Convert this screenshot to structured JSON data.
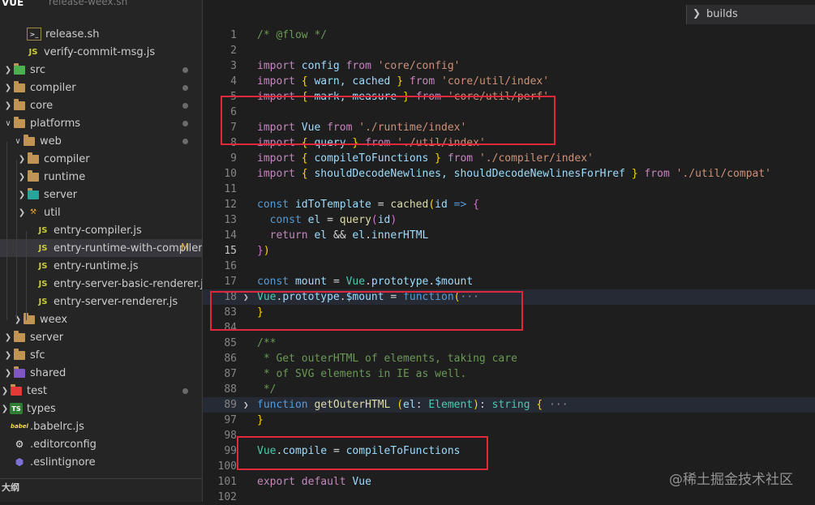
{
  "sidebar": {
    "title": "VUE",
    "faded_top": "release-weex.sh",
    "items": [
      {
        "label": "release.sh",
        "icon": "shell-file-icon"
      },
      {
        "label": "verify-commit-msg.js",
        "icon": "js-file-icon"
      },
      {
        "label": "src",
        "icon": "src-folder-icon"
      },
      {
        "label": "compiler",
        "icon": "folder-icon"
      },
      {
        "label": "core",
        "icon": "folder-icon"
      },
      {
        "label": "platforms",
        "icon": "folder-icon"
      },
      {
        "label": "web",
        "icon": "folder-icon"
      },
      {
        "label": "compiler",
        "icon": "folder-icon"
      },
      {
        "label": "runtime",
        "icon": "folder-icon"
      },
      {
        "label": "server",
        "icon": "server-folder-icon"
      },
      {
        "label": "util",
        "icon": "util-folder-icon"
      },
      {
        "label": "entry-compiler.js",
        "icon": "js-file-icon"
      },
      {
        "label": "entry-runtime-with-compiler.js",
        "icon": "js-file-icon",
        "badge": "M"
      },
      {
        "label": "entry-runtime.js",
        "icon": "js-file-icon"
      },
      {
        "label": "entry-server-basic-renderer.js",
        "icon": "js-file-icon"
      },
      {
        "label": "entry-server-renderer.js",
        "icon": "js-file-icon"
      },
      {
        "label": "weex",
        "icon": "folder-icon"
      },
      {
        "label": "server",
        "icon": "folder-icon"
      },
      {
        "label": "sfc",
        "icon": "folder-icon"
      },
      {
        "label": "shared",
        "icon": "shared-folder-icon"
      },
      {
        "label": "test",
        "icon": "test-folder-icon"
      },
      {
        "label": "types",
        "icon": "ts-folder-icon"
      },
      {
        "label": ".babelrc.js",
        "icon": "babel-file-icon"
      },
      {
        "label": ".editorconfig",
        "icon": "editorconfig-icon"
      },
      {
        "label": ".eslintignore",
        "icon": "eslint-icon"
      }
    ],
    "outline_label": "大纲"
  },
  "breadcrumb": {
    "label": "builds"
  },
  "editor": {
    "line_numbers": [
      "1",
      "2",
      "3",
      "4",
      "5",
      "6",
      "7",
      "8",
      "9",
      "10",
      "11",
      "12",
      "13",
      "14",
      "15",
      "16",
      "17",
      "18",
      "83",
      "84",
      "85",
      "86",
      "87",
      "88",
      "89",
      "97",
      "98",
      "99",
      "100",
      "101",
      "102"
    ],
    "lines": {
      "l1": [
        "/* @flow */"
      ],
      "l3": [
        "import",
        "config",
        "from",
        "'core/config'"
      ],
      "l4": [
        "import",
        "{",
        "warn,",
        "cached",
        "}",
        "from",
        "'core/util/index'"
      ],
      "l5": [
        "import",
        "{",
        "mark,",
        "measure",
        "}",
        "from",
        "'core/util/perf'"
      ],
      "l7": [
        "import",
        "Vue",
        "from",
        "'./runtime/index'"
      ],
      "l8": [
        "import",
        "{",
        "query",
        "}",
        "from",
        "'./util/index'"
      ],
      "l9": [
        "import",
        "{",
        "compileToFunctions",
        "}",
        "from",
        "'./compiler/index'"
      ],
      "l10": [
        "import",
        "{",
        "shouldDecodeNewlines,",
        "shouldDecodeNewlinesForHref",
        "}",
        "from",
        "'./util/compat'"
      ],
      "l12": [
        "const",
        "idToTemplate",
        "=",
        "cached",
        "(",
        "id",
        "=>",
        "{"
      ],
      "l13": [
        "const",
        "el",
        "=",
        "query",
        "(",
        "id",
        ")"
      ],
      "l14": [
        "return",
        "el",
        "&&",
        "el",
        ".",
        "innerHTML"
      ],
      "l15": [
        "}",
        ")"
      ],
      "l17": [
        "const",
        "mount",
        "=",
        "Vue",
        ".",
        "prototype",
        ".",
        "$mount"
      ],
      "l18": [
        "Vue",
        ".",
        "prototype",
        ".",
        "$mount",
        "=",
        "function",
        "(",
        "···"
      ],
      "l83": [
        "}"
      ],
      "l85": [
        "/**"
      ],
      "l86": [
        " * Get outerHTML of elements, taking care"
      ],
      "l87": [
        " * of SVG elements in IE as well."
      ],
      "l88": [
        " */"
      ],
      "l89": [
        "function",
        "getOuterHTML",
        "(",
        "el",
        ":",
        "Element",
        ")",
        ":",
        "string",
        "{",
        "···"
      ],
      "l97": [
        "}"
      ],
      "l99": [
        "Vue",
        ".",
        "compile",
        "=",
        "compileToFunctions"
      ],
      "l101": [
        "export",
        "default",
        "Vue"
      ]
    }
  },
  "watermark": "@稀土掘金技术社区",
  "colors": {
    "annotation_box": "#e0283a",
    "editor_bg": "#1e1e1e",
    "sidebar_bg": "#252526"
  }
}
